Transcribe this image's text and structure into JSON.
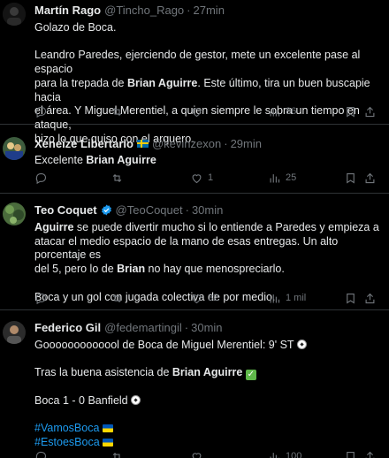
{
  "tweets": [
    {
      "name": "Martín Rago",
      "handle": "@Tincho_Rago",
      "time": "27min",
      "avatar_color": "#1a1a1a",
      "lines": [
        [
          {
            "t": "Golazo de Boca."
          }
        ],
        [],
        [
          {
            "t": "Leandro Paredes, ejerciendo de gestor, mete un excelente pase al espacio"
          }
        ],
        [
          {
            "t": "para la trepada de "
          },
          {
            "t": "Brian Aguirre",
            "b": true
          },
          {
            "t": ". Este último, tira un buen buscapie hacia"
          }
        ],
        [
          {
            "t": "el área. Y Miguel Merentiel, a quien siempre le sobra un tiempo en ataque,"
          }
        ],
        [
          {
            "t": "hizo lo que quiso con el arquero."
          }
        ]
      ],
      "reply_count": "",
      "retweet_count": "",
      "like_count": "",
      "view_count": "86"
    },
    {
      "name": "Xeneize Libertario",
      "handle": "@kevinzexon",
      "time": "29min",
      "avatar_color": "#2c4a2e",
      "lines": [
        [
          {
            "t": "Excelente "
          },
          {
            "t": "Brian Aguirre",
            "b": true
          }
        ]
      ],
      "reply_count": "",
      "retweet_count": "",
      "like_count": "1",
      "view_count": "25"
    },
    {
      "name": "Teo Coquet",
      "handle": "@TeoCoquet",
      "time": "30min",
      "avatar_color": "#3b5d3a",
      "lines": [
        [
          {
            "t": "Aguirre",
            "b": true
          },
          {
            "t": " se puede divertir mucho si lo entiende a Paredes y empieza a"
          }
        ],
        [
          {
            "t": "atacar el medio espacio de la mano de esas entregas. Un alto porcentaje es"
          }
        ],
        [
          {
            "t": "del 5, pero lo de "
          },
          {
            "t": "Brian",
            "b": true
          },
          {
            "t": " no hay que menospreciarlo."
          }
        ],
        [],
        [
          {
            "t": "Boca y un gol con jugada colectiva de por medio."
          }
        ]
      ],
      "reply_count": "",
      "retweet_count": "",
      "like_count": "32",
      "view_count": "1 mil"
    },
    {
      "name": "Federico Gil",
      "handle": "@fedemartingil",
      "time": "30min",
      "avatar_color": "#3a3a3a",
      "lines": [
        [
          {
            "t": "Gooooooooooool de Boca de Miguel Merentiel: 9' ST "
          },
          {
            "e": "ball"
          }
        ],
        [],
        [
          {
            "t": "Tras la buena asistencia de "
          },
          {
            "t": "Brian Aguirre",
            "b": true
          },
          {
            "t": " "
          },
          {
            "e": "check"
          }
        ],
        [],
        [
          {
            "t": "Boca 1 - 0 Banfield "
          },
          {
            "e": "ball"
          }
        ],
        [],
        [
          {
            "t": "#VamosBoca",
            "tag": true
          },
          {
            "t": " "
          },
          {
            "e": "ua"
          }
        ],
        [
          {
            "t": "#EstoesBoca",
            "tag": true
          },
          {
            "t": " "
          },
          {
            "e": "ua"
          }
        ]
      ],
      "reply_count": "",
      "retweet_count": "",
      "like_count": "",
      "view_count": "100"
    }
  ],
  "dot": "·",
  "colors": {
    "background": "#000000",
    "muted": "#71767b",
    "link": "#1d9bf0",
    "divider": "#2f3336",
    "verified": "#1d9bf0"
  }
}
